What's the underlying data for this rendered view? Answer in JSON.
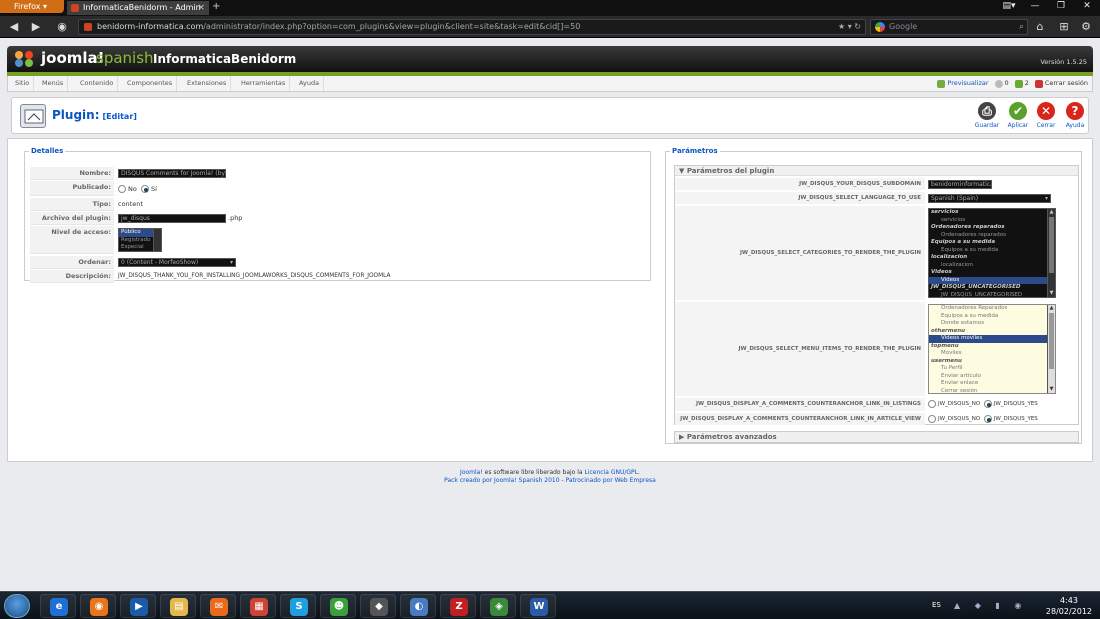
{
  "browser": {
    "app_button": "Firefox",
    "tab_title": "InformaticaBenidorm - Admin",
    "url_host": "benidorm-informatica.com",
    "url_path": "/administrator/index.php?option=com_plugins&view=plugin&client=site&task=edit&cid[]=50",
    "search_placeholder": "Google"
  },
  "header": {
    "logo_text": "joomla!",
    "logo_lang": "spanish",
    "site_name": "InformaticaBenidorm",
    "version": "Versión 1.5.25"
  },
  "menu": [
    "Sitio",
    "Menús",
    "Contenido",
    "Componentes",
    "Extensiones",
    "Herramientas",
    "Ayuda"
  ],
  "status": {
    "preview": "Previsualizar",
    "messages": "0",
    "users": "2",
    "logout": "Cerrar sesión"
  },
  "toolbar": {
    "title": "Plugin:",
    "title_sub": "[Editar]",
    "buttons": [
      {
        "label": "Guardar",
        "color": "#444444"
      },
      {
        "label": "Aplicar",
        "color": "#5aa02c"
      },
      {
        "label": "Cerrar",
        "color": "#d8261a"
      },
      {
        "label": "Ayuda",
        "color": "#d8261a"
      }
    ]
  },
  "details": {
    "legend": "Detalles",
    "labels": [
      "Nombre:",
      "Publicado:",
      "Tipo:",
      "Archivo del plugin:",
      "Nivel de acceso:",
      "Ordenar:",
      "Descripción:"
    ],
    "name_value": "DISQUS Comments for Joomla! (by Joo",
    "published_no": "No",
    "published_yes": "Sí",
    "type_value": "content",
    "file_value": "jw_disqus",
    "file_ext": ".php",
    "access_options": [
      "Público",
      "Registrado",
      "Especial"
    ],
    "order_value": "0 (Content - MorfeoShow)",
    "description": "JW_DISQUS_THANK_YOU_FOR_INSTALLING_JOOMLAWORKS_DISQUS_COMMENTS_FOR_JOOMLA"
  },
  "params": {
    "legend": "Parámetros",
    "panel_title": "Parámetros del plugin",
    "advanced_title": "Parámetros avanzados",
    "labels": [
      "JW_DISQUS_YOUR_DISQUS_SUBDOMAIN",
      "JW_DISQUS_SELECT_LANGUAGE_TO_USE",
      "JW_DISQUS_SELECT_CATEGORIES_TO_RENDER_THE_PLUGIN",
      "JW_DISQUS_SELECT_MENU_ITEMS_TO_RENDER_THE_PLUGIN",
      "JW_DISQUS_DISPLAY_A_COMMENTS_COUNTERANCHOR_LINK_IN_LISTINGS",
      "JW_DISQUS_DISPLAY_A_COMMENTS_COUNTERANCHOR_LINK_IN_ARTICLE_VIEW"
    ],
    "subdomain_value": "benidorminformatica",
    "language_value": "Spanish (Spain)",
    "categories": [
      {
        "text": "servicios",
        "kind": "group"
      },
      {
        "text": "servicios",
        "kind": "item"
      },
      {
        "text": "Ordenadores reparados",
        "kind": "group"
      },
      {
        "text": "Ordenadores reparados",
        "kind": "item"
      },
      {
        "text": "Equipos a su medida",
        "kind": "group"
      },
      {
        "text": "Equipos a su medida",
        "kind": "item"
      },
      {
        "text": "localizacion",
        "kind": "group"
      },
      {
        "text": "localizacion",
        "kind": "item"
      },
      {
        "text": "Videos",
        "kind": "group"
      },
      {
        "text": "Videos",
        "kind": "selected"
      },
      {
        "text": "JW_DISQUS_UNCATEGORISED",
        "kind": "group"
      },
      {
        "text": "JW_DISQUS_UNCATEGORISED",
        "kind": "item"
      }
    ],
    "menu_items": [
      {
        "text": "Ordenadores Reparados",
        "kind": "item"
      },
      {
        "text": "Equipos a su medida",
        "kind": "item"
      },
      {
        "text": "Donde estamos",
        "kind": "item"
      },
      {
        "text": "othermenu",
        "kind": "group"
      },
      {
        "text": "Videos moviles",
        "kind": "selected"
      },
      {
        "text": "topmenu",
        "kind": "group"
      },
      {
        "text": "Moviles",
        "kind": "item"
      },
      {
        "text": "usermenu",
        "kind": "group"
      },
      {
        "text": "Tu Perfil",
        "kind": "item"
      },
      {
        "text": "Enviar artículo",
        "kind": "item"
      },
      {
        "text": "Enviar enlace",
        "kind": "item"
      },
      {
        "text": "Cerrar sesión",
        "kind": "item"
      }
    ],
    "no_label": "JW_DISQUS_NO",
    "yes_label": "JW_DISQUS_YES"
  },
  "footer": {
    "line1_link1": "Joomla!",
    "line1_text": " es software libre liberado bajo la ",
    "line1_link2": "Licencia GNU/GPL",
    "line2_link1": "Pack creado por Joomla! Spanish 2010",
    "line2_sep": " - ",
    "line2_link2": "Patrocinado por Web Empresa"
  },
  "taskbar": {
    "lang": "ES",
    "time": "4:43",
    "date": "28/02/2012"
  },
  "colors": {
    "accent_green": "#76a023",
    "link_blue": "#0b55c4",
    "firefox_orange": "#d16d15"
  }
}
